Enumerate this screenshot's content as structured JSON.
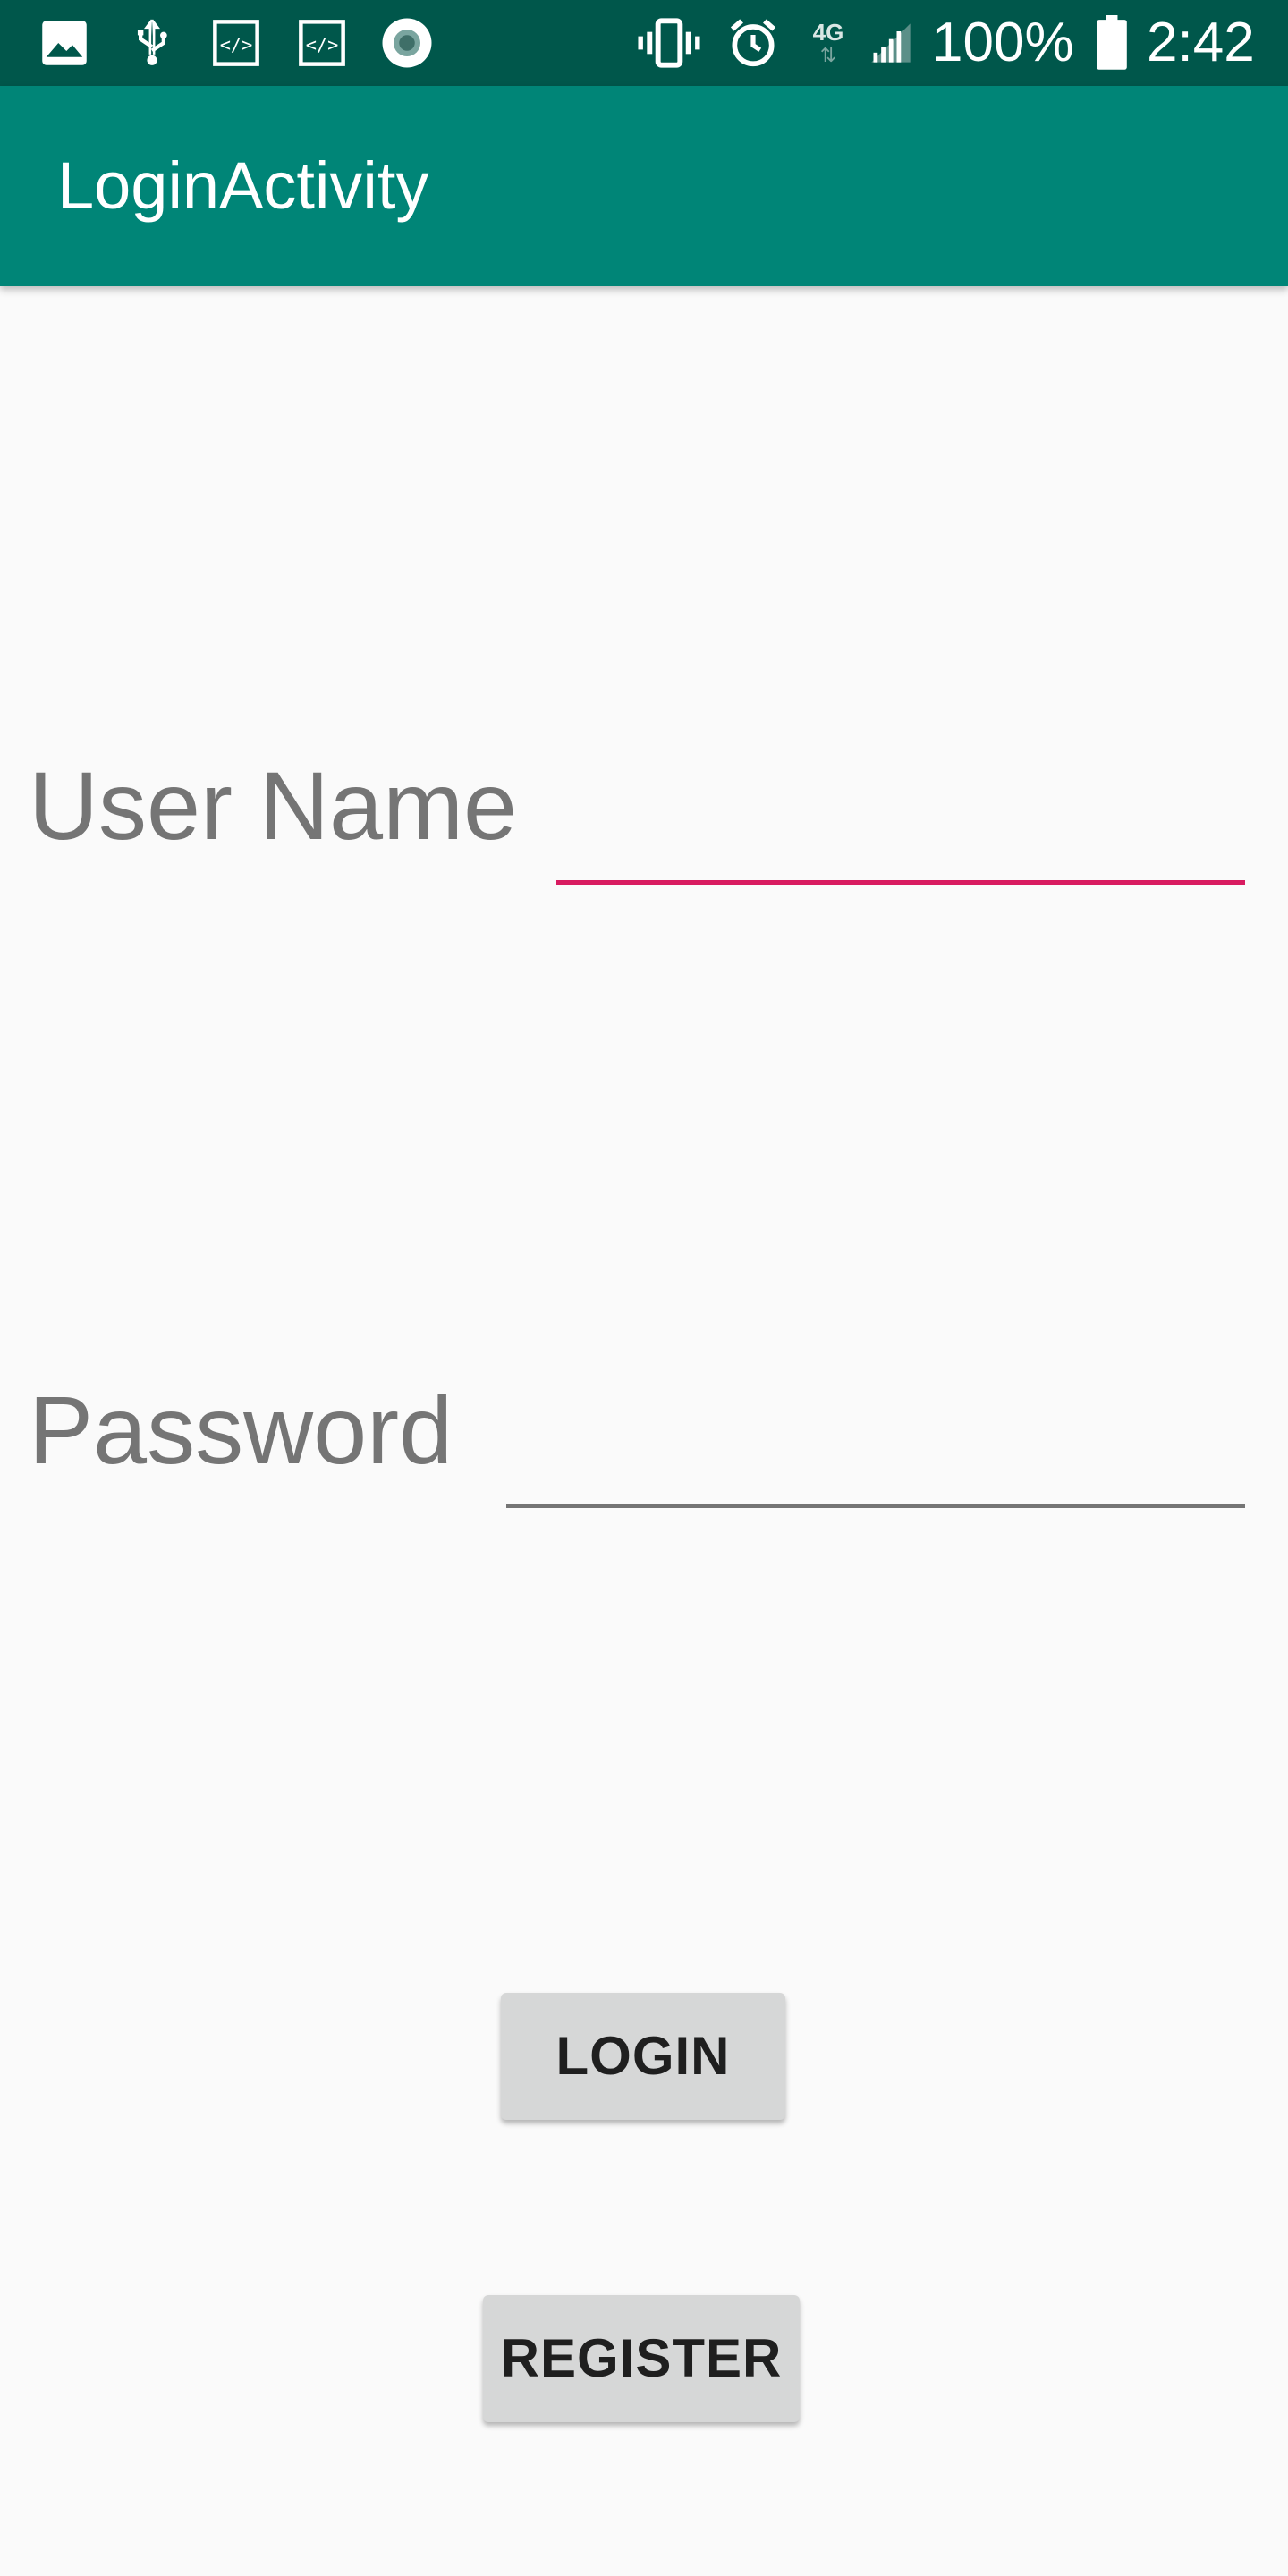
{
  "status_bar": {
    "battery_percent": "100%",
    "time": "2:42",
    "network_type": "4G",
    "icons": [
      "image-icon",
      "usb-icon",
      "code-icon",
      "code-icon",
      "record-icon",
      "vibrate-icon",
      "alarm-icon",
      "network-4g-icon",
      "signal-icon",
      "battery-icon"
    ]
  },
  "app_bar": {
    "title": "LoginActivity"
  },
  "form": {
    "username": {
      "label": "User Name",
      "value": "",
      "placeholder": ""
    },
    "password": {
      "label": "Password",
      "value": "",
      "placeholder": ""
    }
  },
  "buttons": {
    "login_label": "LOGIN",
    "register_label": "REGISTER"
  },
  "colors": {
    "status_bar": "#00574b",
    "app_bar": "#008577",
    "accent": "#d81b60",
    "background": "#fafafa",
    "button": "#d6d7d7"
  }
}
